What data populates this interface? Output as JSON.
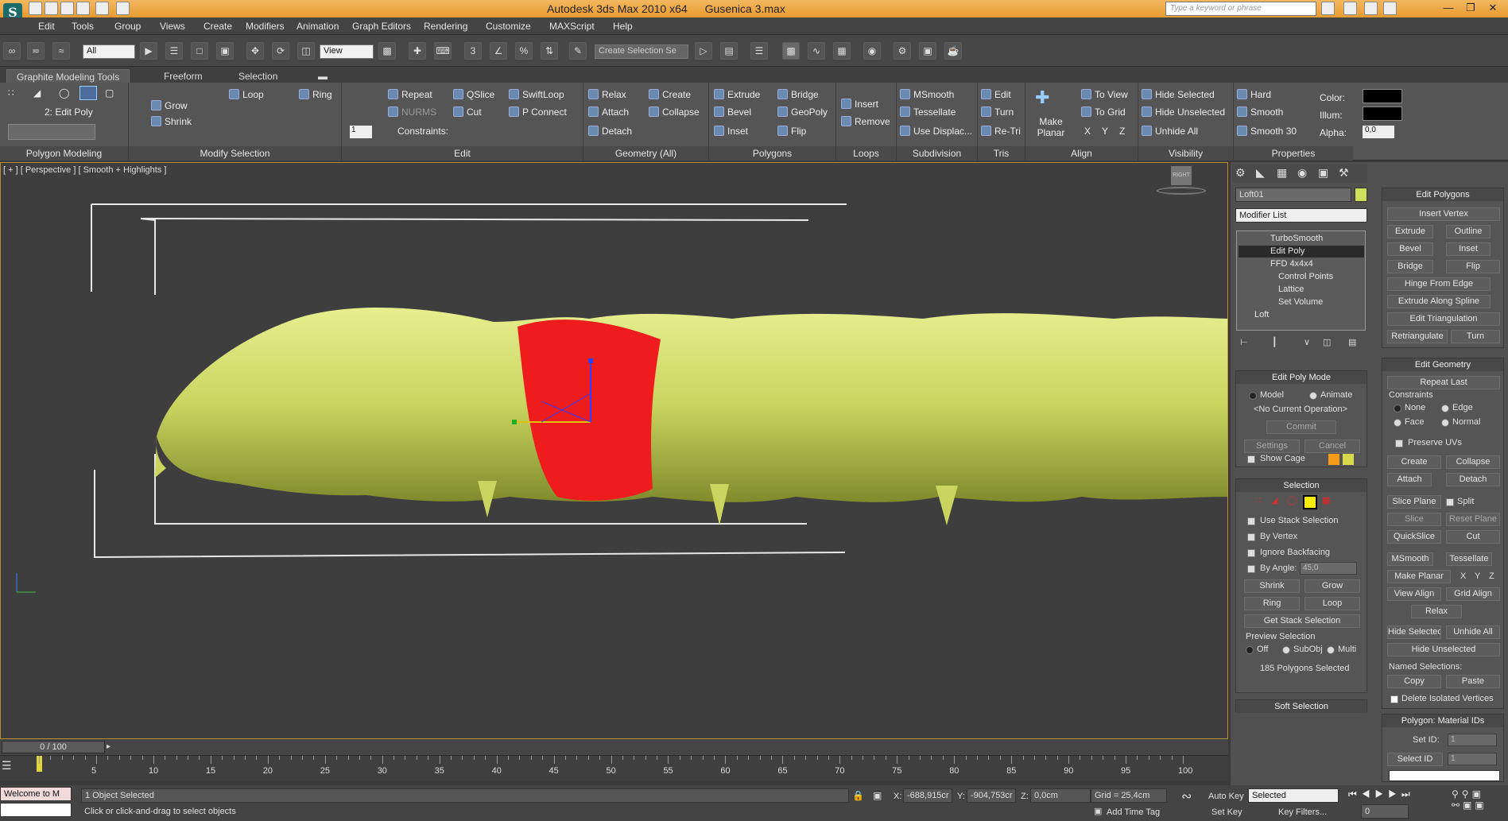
{
  "title_bar": {
    "app": "Autodesk 3ds Max  2010 x64",
    "file": "Gusenica 3.max",
    "search_placeholder": "Type a keyword or phrase",
    "logo": "S"
  },
  "menu": [
    "Edit",
    "Tools",
    "Group",
    "Views",
    "Create",
    "Modifiers",
    "Animation",
    "Graph Editors",
    "Rendering",
    "Customize",
    "MAXScript",
    "Help"
  ],
  "main_toolbar": {
    "filter": "All",
    "ref_coord": "View",
    "named_selection": "Create Selection Se"
  },
  "ribbon_tabs": [
    "Graphite Modeling Tools",
    "Freeform",
    "Selection"
  ],
  "ribbon": {
    "polygon_modeling": {
      "label": "Polygon Modeling",
      "level": "2: Edit Poly"
    },
    "modify_selection": {
      "label": "Modify Selection",
      "grow": "Grow",
      "shrink": "Shrink",
      "loop": "Loop",
      "ring": "Ring"
    },
    "edit": {
      "label": "Edit",
      "repeat": "Repeat",
      "qslice": "QSlice",
      "swiftloop": "SwiftLoop",
      "nurms": "NURMS",
      "cut": "Cut",
      "pconnect": "P Connect",
      "constraints": "Constraints:",
      "spinner": "1"
    },
    "geometry": {
      "label": "Geometry (All)",
      "relax": "Relax",
      "create": "Create",
      "attach": "Attach",
      "collapse": "Collapse",
      "detach": "Detach"
    },
    "polygons": {
      "label": "Polygons",
      "extrude": "Extrude",
      "bridge": "Bridge",
      "bevel": "Bevel",
      "geopoly": "GeoPoly",
      "inset": "Inset",
      "flip": "Flip"
    },
    "loops": {
      "label": "Loops",
      "insert": "Insert",
      "remove": "Remove"
    },
    "subdivision": {
      "label": "Subdivision",
      "msmooth": "MSmooth",
      "tessellate": "Tessellate",
      "use_displace": "Use Displac..."
    },
    "tris": {
      "label": "Tris",
      "edit": "Edit",
      "turn": "Turn",
      "retri": "Re-Tri"
    },
    "align": {
      "label": "Align",
      "make_planar": "Make Planar",
      "to_view": "To View",
      "to_grid": "To Grid",
      "x": "X",
      "y": "Y",
      "z": "Z"
    },
    "visibility": {
      "label": "Visibility",
      "hide_sel": "Hide Selected",
      "hide_unsel": "Hide Unselected",
      "unhide": "Unhide All"
    },
    "smoothing": {
      "hard": "Hard",
      "smooth": "Smooth",
      "smooth30": "Smooth 30"
    },
    "properties": {
      "label": "Properties",
      "color": "Color:",
      "illum": "Illum:",
      "alpha": "Alpha:",
      "alpha_val": "0,0"
    }
  },
  "viewport": {
    "label": "[ + ] [ Perspective ] [ Smooth + Highlights ]",
    "viewcube": "RIGHT"
  },
  "command_panel": {
    "object_name": "Loft01",
    "modifier_list": "Modifier List",
    "stack": [
      "TurboSmooth",
      "Edit Poly",
      "FFD 4x4x4",
      "Control Points",
      "Lattice",
      "Set Volume",
      "Loft"
    ],
    "edit_poly_mode": {
      "title": "Edit Poly Mode",
      "model": "Model",
      "animate": "Animate",
      "current_op": "<No Current Operation>",
      "commit": "Commit",
      "settings": "Settings",
      "cancel": "Cancel",
      "show_cage": "Show Cage"
    },
    "selection": {
      "title": "Selection",
      "use_stack": "Use Stack Selection",
      "by_vertex": "By Vertex",
      "ignore_backfacing": "Ignore Backfacing",
      "by_angle": "By Angle:",
      "angle_val": "45,0",
      "shrink": "Shrink",
      "grow": "Grow",
      "ring": "Ring",
      "loop": "Loop",
      "get_stack": "Get Stack Selection",
      "preview": "Preview Selection",
      "off": "Off",
      "subobj": "SubObj",
      "multi": "Multi",
      "count": "185 Polygons Selected"
    },
    "soft_selection": "Soft Selection",
    "edit_polygons": {
      "title": "Edit Polygons",
      "insert_vertex": "Insert Vertex",
      "extrude": "Extrude",
      "outline": "Outline",
      "bevel": "Bevel",
      "inset": "Inset",
      "bridge": "Bridge",
      "flip": "Flip",
      "hinge": "Hinge From Edge",
      "extrude_spline": "Extrude Along Spline",
      "edit_tri": "Edit Triangulation",
      "retri": "Retriangulate",
      "turn": "Turn"
    },
    "edit_geometry": {
      "title": "Edit Geometry",
      "repeat": "Repeat Last",
      "constraints": "Constraints",
      "none": "None",
      "edge": "Edge",
      "face": "Face",
      "normal": "Normal",
      "preserve_uvs": "Preserve UVs",
      "create": "Create",
      "collapse": "Collapse",
      "attach": "Attach",
      "detach": "Detach",
      "slice_plane": "Slice Plane",
      "split": "Split",
      "slice": "Slice",
      "reset_plane": "Reset Plane",
      "quickslice": "QuickSlice",
      "cut": "Cut",
      "msmooth": "MSmooth",
      "tessellate": "Tessellate",
      "make_planar": "Make Planar",
      "x": "X",
      "y": "Y",
      "z": "Z",
      "view_align": "View Align",
      "grid_align": "Grid Align",
      "relax": "Relax",
      "hide_sel": "Hide Selected",
      "unhide_all": "Unhide All",
      "hide_unsel": "Hide Unselected",
      "named_sel": "Named Selections:",
      "copy": "Copy",
      "paste": "Paste",
      "delete_iso": "Delete Isolated Vertices"
    },
    "material_ids": {
      "title": "Polygon: Material IDs",
      "set_id": "Set ID:",
      "set_val": "1",
      "select_id": "Select ID",
      "select_val": "1"
    }
  },
  "timeline": {
    "frame": "0 / 100",
    "ticks": [
      "5",
      "10",
      "15",
      "20",
      "25",
      "30",
      "35",
      "40",
      "45",
      "50",
      "55",
      "60",
      "65",
      "70",
      "75",
      "80",
      "85",
      "90",
      "95",
      "100"
    ]
  },
  "status": {
    "maxscript": "Welcome to M",
    "selected": "1 Object Selected",
    "prompt": "Click or click-and-drag to select objects",
    "x_label": "X:",
    "x": "-688,915cr",
    "y_label": "Y:",
    "y": "-904,753cr",
    "z_label": "Z:",
    "z": "0,0cm",
    "grid": "Grid = 25,4cm",
    "add_time_tag": "Add Time Tag",
    "auto_key": "Auto Key",
    "set_key": "Set Key",
    "key_mode": "Selected",
    "key_filters": "Key Filters...",
    "frame_field": "0"
  },
  "colors": {
    "titlebar": "#e9a13a",
    "mesh": "#cdd96a",
    "selection": "#ee1c1c",
    "viewport_border": "#b88d35"
  }
}
